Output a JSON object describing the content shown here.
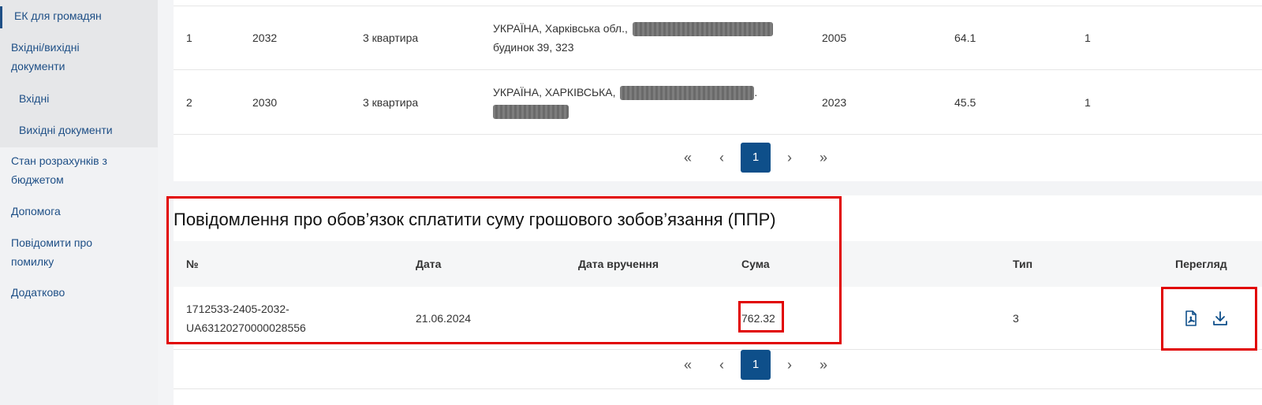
{
  "sidebar": {
    "items": [
      {
        "label": "ЕК для громадян"
      },
      {
        "label": "Вхідні/вихідні документи"
      },
      {
        "label": "Вхідні"
      },
      {
        "label": "Вихідні документи"
      },
      {
        "label": "Стан розрахунків з бюджетом"
      },
      {
        "label": "Допомога"
      },
      {
        "label": "Повідомити про помилку"
      },
      {
        "label": "Додатково"
      }
    ]
  },
  "property_table": {
    "rows": [
      {
        "n": "1",
        "code": "2032",
        "type": "3 квартира",
        "address_line1": "УКРАЇНА, Харківська обл.,",
        "address_line2": "будинок 39, 323",
        "year": "2005",
        "area": "64.1",
        "count": "1"
      },
      {
        "n": "2",
        "code": "2030",
        "type": "3 квартира",
        "address_line1": "УКРАЇНА, ХАРКІВСЬКА,",
        "address_line1_suffix": ".",
        "year": "2023",
        "area": "45.5",
        "count": "1"
      }
    ],
    "pager": {
      "first": "«",
      "prev": "‹",
      "current": "1",
      "next": "›",
      "last": "»"
    }
  },
  "ppr_section": {
    "title": "Повідомлення про обов’язок сплатити суму грошового зобов’язання (ППР)",
    "headers": {
      "number": "№",
      "date": "Дата",
      "delivery_date": "Дата вручення",
      "amount": "Сума",
      "type": "Тип",
      "view": "Перегляд"
    },
    "rows": [
      {
        "number_line1": "1712533-2405-2032-",
        "number_line2": "UA63120270000028556",
        "date": "21.06.2024",
        "delivery_date": "",
        "amount": "762.32",
        "type": "3"
      }
    ],
    "pager": {
      "first": "«",
      "prev": "‹",
      "current": "1",
      "next": "›",
      "last": "»"
    },
    "icons": {
      "pdf": "pdf-file-icon",
      "download": "download-icon"
    }
  },
  "colors": {
    "accent": "#0e4f8a",
    "link": "#1e4f86",
    "highlight": "#e10000"
  }
}
